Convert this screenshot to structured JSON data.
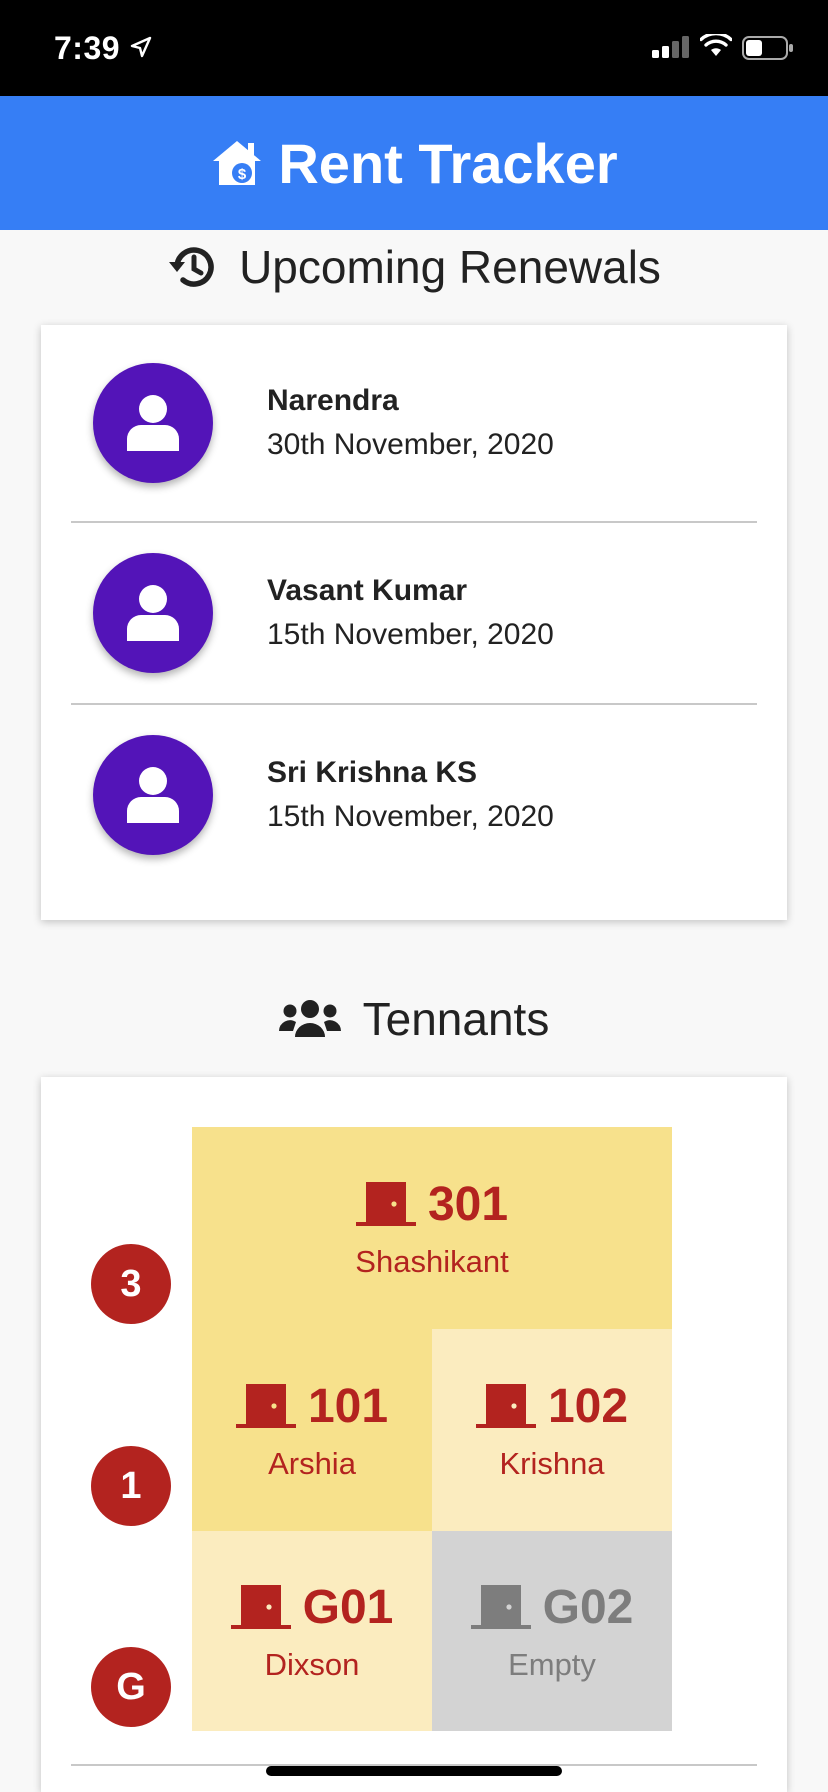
{
  "status": {
    "time": "7:39"
  },
  "app": {
    "title": "Rent Tracker"
  },
  "renewals": {
    "title": "Upcoming Renewals",
    "items": [
      {
        "name": "Narendra",
        "date": "30th November, 2020"
      },
      {
        "name": "Vasant Kumar",
        "date": "15th November, 2020"
      },
      {
        "name": "Sri Krishna KS",
        "date": "15th November, 2020"
      }
    ]
  },
  "tenants": {
    "title": "Tennants",
    "floors": [
      {
        "label": "3",
        "units": [
          {
            "number": "301",
            "tenant": "Shashikant",
            "occupied": true
          }
        ]
      },
      {
        "label": "1",
        "units": [
          {
            "number": "101",
            "tenant": "Arshia",
            "occupied": true
          },
          {
            "number": "102",
            "tenant": "Krishna",
            "occupied": true
          }
        ]
      },
      {
        "label": "G",
        "units": [
          {
            "number": "G01",
            "tenant": "Dixson",
            "occupied": true
          },
          {
            "number": "G02",
            "tenant": "Empty",
            "occupied": false
          }
        ]
      }
    ]
  },
  "colors": {
    "appbar": "#367ef5",
    "avatar": "#5314b8",
    "accent_red": "#b3231f",
    "unit_dark": "#f7e18c",
    "unit_light": "#fbecbf",
    "unit_empty": "#d3d3d3"
  }
}
